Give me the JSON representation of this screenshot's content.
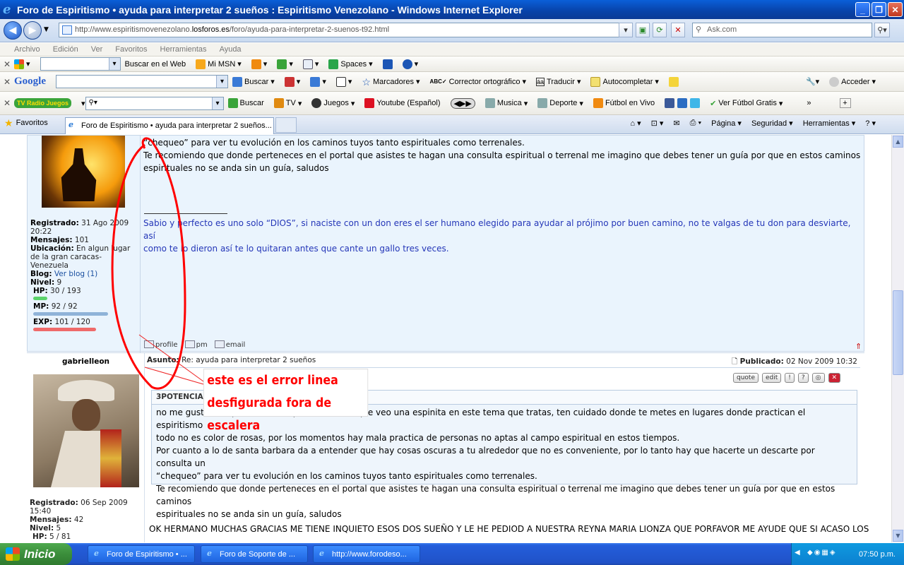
{
  "window": {
    "title": "Foro de Espiritismo • ayuda para interpretar 2 sueños : Espiritismo Venezolano - Windows Internet Explorer",
    "minimize": "_",
    "maximize": "❐",
    "close": "✕"
  },
  "nav": {
    "url_prefix": "http://www.espiritismovenezolano.",
    "url_domain": "losforos.es",
    "url_path": "/foro/ayuda-para-interpretar-2-suenos-t92.html",
    "search_placeholder": "Ask.com"
  },
  "menu": [
    "Archivo",
    "Edición",
    "Ver",
    "Favoritos",
    "Herramientas",
    "Ayuda"
  ],
  "toolbar1": {
    "search_web": "Buscar en el Web",
    "msn": "Mi MSN",
    "spaces": "Spaces"
  },
  "toolbar_google": {
    "brand": "Google",
    "buscar": "Buscar",
    "marcadores": "Marcadores",
    "corrector": "Corrector ortográfico",
    "traducir": "Traducir",
    "autocompletar": "Autocompletar",
    "acceder": "Acceder"
  },
  "toolbar_tv": {
    "brand": "TV Radio Juegos",
    "buscar": "Buscar",
    "tv": "TV",
    "juegos": "Juegos",
    "youtube": "Youtube (Español)",
    "musica": "Musica",
    "deporte": "Deporte",
    "futbol": "Fútbol en Vivo",
    "ver_futbol": "Ver Fútbol Gratis"
  },
  "tabs": {
    "favoritos": "Favoritos",
    "active_tab": "Foro de Espiritismo • ayuda para interpretar 2 sueños...",
    "cmd": [
      "Página",
      "Seguridad",
      "Herramientas"
    ]
  },
  "post1": {
    "body": [
      "“chequeo” para ver tu evolución en los caminos tuyos tanto espirituales como terrenales.",
      "Te recomiendo que donde perteneces en el portal que asistes te hagan una consulta espiritual o terrenal me imagino que debes tener un guía por que en estos caminos",
      "espirituales no se anda sin un guía, saludos"
    ],
    "signature": [
      "Sabio y perfecto es uno solo “DIOS”, si naciste con un don eres el ser humano elegido para ayudar al prójimo por buen camino, no te valgas de tu don para desviarte, así",
      "como te lo dieron así te lo quitaran antes que cante un gallo tres veces."
    ],
    "user": {
      "registrado_label": "Registrado:",
      "registrado": "31 Ago 2009 20:22",
      "mensajes_label": "Mensajes:",
      "mensajes": "101",
      "ubicacion_label": "Ubicación:",
      "ubicacion": "En algun lugar de la gran caracas-Venezuela",
      "blog_label": "Blog:",
      "blog": "Ver blog (1)",
      "nivel_label": "Nivel:",
      "nivel": "9",
      "hp_label": "HP:",
      "hp": "30 / 193",
      "mp_label": "MP:",
      "mp": "92 / 92",
      "exp_label": "EXP:",
      "exp": "101 / 120",
      "hp_frac": 0.155,
      "mp_frac": 1.0,
      "exp_frac": 0.84
    },
    "links": [
      "profile",
      "pm",
      "email"
    ]
  },
  "post2": {
    "username": "gabrielleon",
    "subject_label": "Asunto:",
    "subject": "Re: ayuda para interpretar 2 sueños",
    "published_label": "Publicado:",
    "published": "02 Nov 2009 10:32",
    "buttons": [
      "quote",
      "edit",
      "!",
      "?",
      "◎",
      "✕"
    ],
    "quote_header": "3POTENCIAS e",
    "quote_body": [
      "no me gusta interpretar sueños pero la verdad que veo una espinita en este tema que tratas, ten cuidado donde te metes en lugares donde practican el espiritismo",
      "todo no es color de rosas, por los momentos hay mala practica de personas no aptas al campo espiritual en estos tiempos.",
      "Por cuanto a lo de santa barbara da a entender que hay cosas oscuras a tu alrededor que no es conveniente, por lo tanto hay que hacerte un descarte por consulta un",
      "“chequeo” para ver tu evolución en los caminos tuyos tanto espirituales como terrenales.",
      "Te recomiendo que donde perteneces en el portal que asistes te hagan una consulta espiritual o terrenal me imagino que debes tener un guía por que en estos caminos",
      "espirituales no se anda sin un guía, saludos"
    ],
    "reply": "OK HERMANO MUCHAS GRACIAS ME TIENE INQUIETO ESOS DOS SUEÑO Y LE HE PEDIOD A NUESTRA REYNA MARIA LIONZA QUE PORFAVOR ME AYUDE QUE SI ACASO LOS",
    "user": {
      "registrado_label": "Registrado:",
      "registrado": "06 Sep 2009 15:40",
      "mensajes_label": "Mensajes:",
      "mensajes": "42",
      "nivel_label": "Nivel:",
      "nivel": "5",
      "hp_label": "HP:",
      "hp": "5 / 81"
    }
  },
  "annotation": [
    "este es el error linea",
    "desfigurada fora de escalera"
  ],
  "taskbar": {
    "start": "Inicio",
    "tasks": [
      "Foro de Espiritismo • ...",
      "Foro de Soporte de ...",
      "http://www.forodeso..."
    ],
    "clock": "07:50 p.m."
  }
}
